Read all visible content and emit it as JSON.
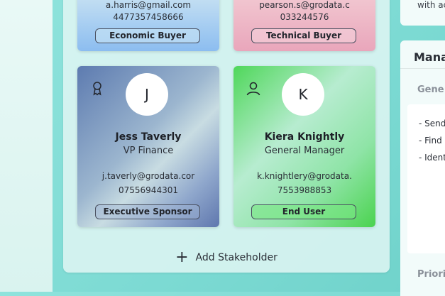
{
  "stakeholders": [
    {
      "email": "a.harris@gmail.com",
      "phone": "4477357458666",
      "role": "Economic Buyer"
    },
    {
      "email": "pearson.s@grodata.c",
      "phone": "033244576",
      "role": "Technical Buyer"
    },
    {
      "initial": "J",
      "role_icon": "ribbon-icon",
      "name": "Jess Taverly",
      "title": "VP Finance",
      "email": "j.taverly@grodata.cor",
      "phone": "07556944301",
      "role": "Executive Sponsor"
    },
    {
      "initial": "K",
      "role_icon": "user-icon",
      "name": "Kiera Knightly",
      "title": "General Manager",
      "email": "k.knightlery@grodata.",
      "phone": "7553988853",
      "role": "End User"
    }
  ],
  "add_stakeholder_label": "Add Stakeholder",
  "right_panel": {
    "top_text": "with ac",
    "heading": "Mana",
    "section_label": "Gene",
    "lines": [
      "- Send",
      "- Find",
      "- Ident"
    ],
    "priority_label": "Priorit"
  },
  "colors": {
    "background": "#7cdad3",
    "card_blue": "#8cbdf0",
    "card_pink": "#e9a6bb",
    "card_slate": "#5d7bb0",
    "card_green": "#4fd75a"
  }
}
